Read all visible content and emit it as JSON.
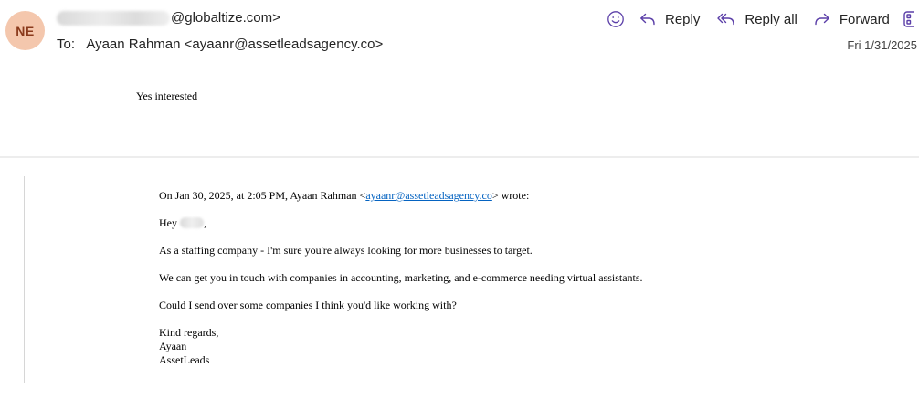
{
  "header": {
    "avatar_initials": "NE",
    "from_domain": "@globaltize.com>",
    "to_label": "To:",
    "to_value": "Ayaan Rahman <ayaanr@assetleadsagency.co>",
    "date": "Fri 1/31/2025",
    "actions": {
      "reply_label": "Reply",
      "reply_all_label": "Reply all",
      "forward_label": "Forward"
    },
    "icons": [
      "emoji-icon",
      "reply-icon",
      "reply-all-icon",
      "forward-icon",
      "more-apps-icon"
    ],
    "accent_color": "#5b3fa8"
  },
  "reply_body": "Yes interested",
  "quoted": {
    "attribution_prefix": "On Jan 30, 2025, at 2:05 PM, Ayaan Rahman <",
    "attribution_link": "ayaanr@assetleadsagency.co",
    "attribution_suffix": "> wrote:",
    "greeting_prefix": "Hey",
    "greeting_suffix": ",",
    "paragraph1": "As a staffing company - I'm sure you're always looking for more businesses to target.",
    "paragraph2": "We can get you in touch with companies in accounting, marketing, and e-commerce needing virtual assistants.",
    "paragraph3": "Could I send over some companies I think you'd like working with?",
    "signoff": "Kind regards,",
    "sig_name": "Ayaan",
    "sig_company": "AssetLeads"
  }
}
